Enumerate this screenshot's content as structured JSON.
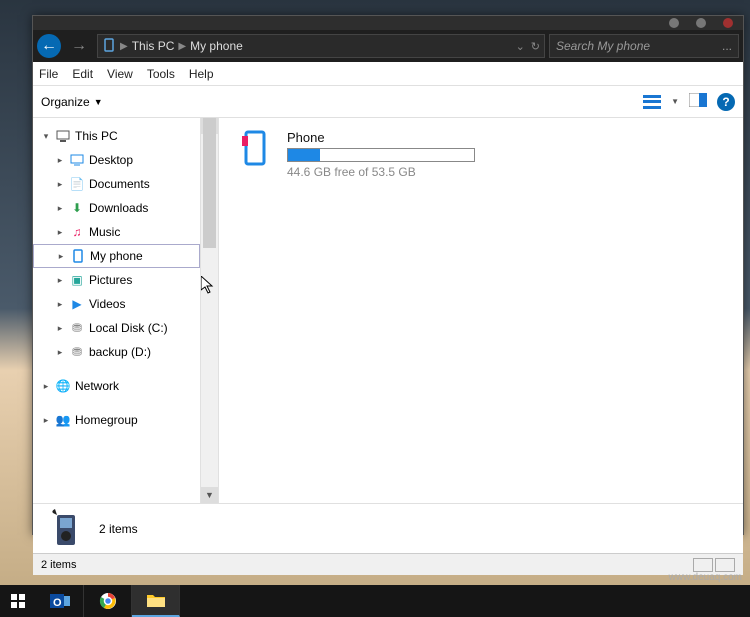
{
  "breadcrumb": {
    "root": "This PC",
    "sep": "▶",
    "loc": "My phone"
  },
  "search": {
    "placeholder": "Search My phone",
    "dots": "..."
  },
  "menu": {
    "file": "File",
    "edit": "Edit",
    "view": "View",
    "tools": "Tools",
    "help": "Help"
  },
  "cmd": {
    "organize": "Organize"
  },
  "tree": {
    "thispc": "This PC",
    "desktop": "Desktop",
    "documents": "Documents",
    "downloads": "Downloads",
    "music": "Music",
    "myphone": "My phone",
    "pictures": "Pictures",
    "videos": "Videos",
    "localc": "Local Disk (C:)",
    "backupd": "backup (D:)",
    "network": "Network",
    "homegroup": "Homegroup"
  },
  "device": {
    "name": "Phone",
    "free_text": "44.6 GB free of 53.5 GB",
    "free_gb": 44.6,
    "total_gb": 53.5
  },
  "details": {
    "count": "2 items"
  },
  "status": {
    "text": "2 items"
  },
  "watermark": "www.deuaq.com"
}
